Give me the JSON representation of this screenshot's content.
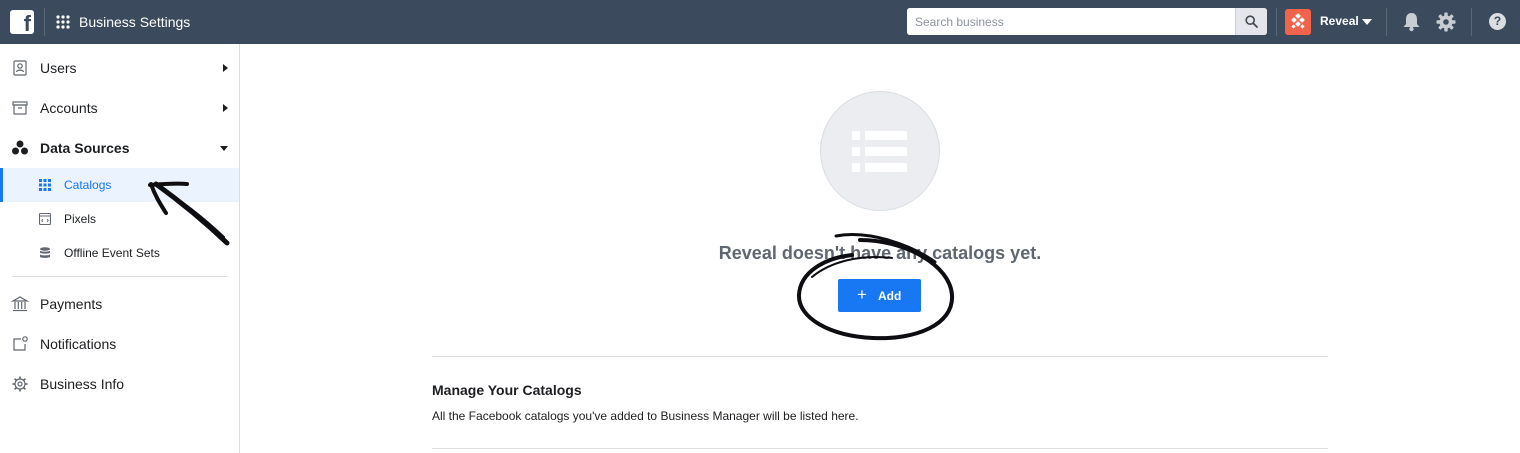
{
  "topbar": {
    "app_title": "Business Settings",
    "search_placeholder": "Search business",
    "business_name": "Reveal",
    "help_glyph": "?"
  },
  "sidebar": {
    "items": [
      {
        "label": "Users",
        "icon": "users-icon"
      },
      {
        "label": "Accounts",
        "icon": "accounts-icon"
      },
      {
        "label": "Data Sources",
        "icon": "data-sources-icon"
      },
      {
        "label": "Payments",
        "icon": "payments-icon"
      },
      {
        "label": "Notifications",
        "icon": "notifications-icon"
      },
      {
        "label": "Business Info",
        "icon": "business-info-icon"
      }
    ],
    "subitems": [
      {
        "label": "Catalogs",
        "icon": "catalog-grid-icon",
        "active": true
      },
      {
        "label": "Pixels",
        "icon": "pixel-code-icon"
      },
      {
        "label": "Offline Event Sets",
        "icon": "database-icon"
      }
    ]
  },
  "main": {
    "empty_title": "Reveal doesn't have any catalogs yet.",
    "add_label": "Add",
    "add_plus": "+",
    "section_title": "Manage Your Catalogs",
    "section_desc": "All the Facebook catalogs you've added to Business Manager will be listed here."
  },
  "colors": {
    "topbar": "#3b4a5c",
    "accent": "#1877f2",
    "brand": "#f1634a"
  }
}
